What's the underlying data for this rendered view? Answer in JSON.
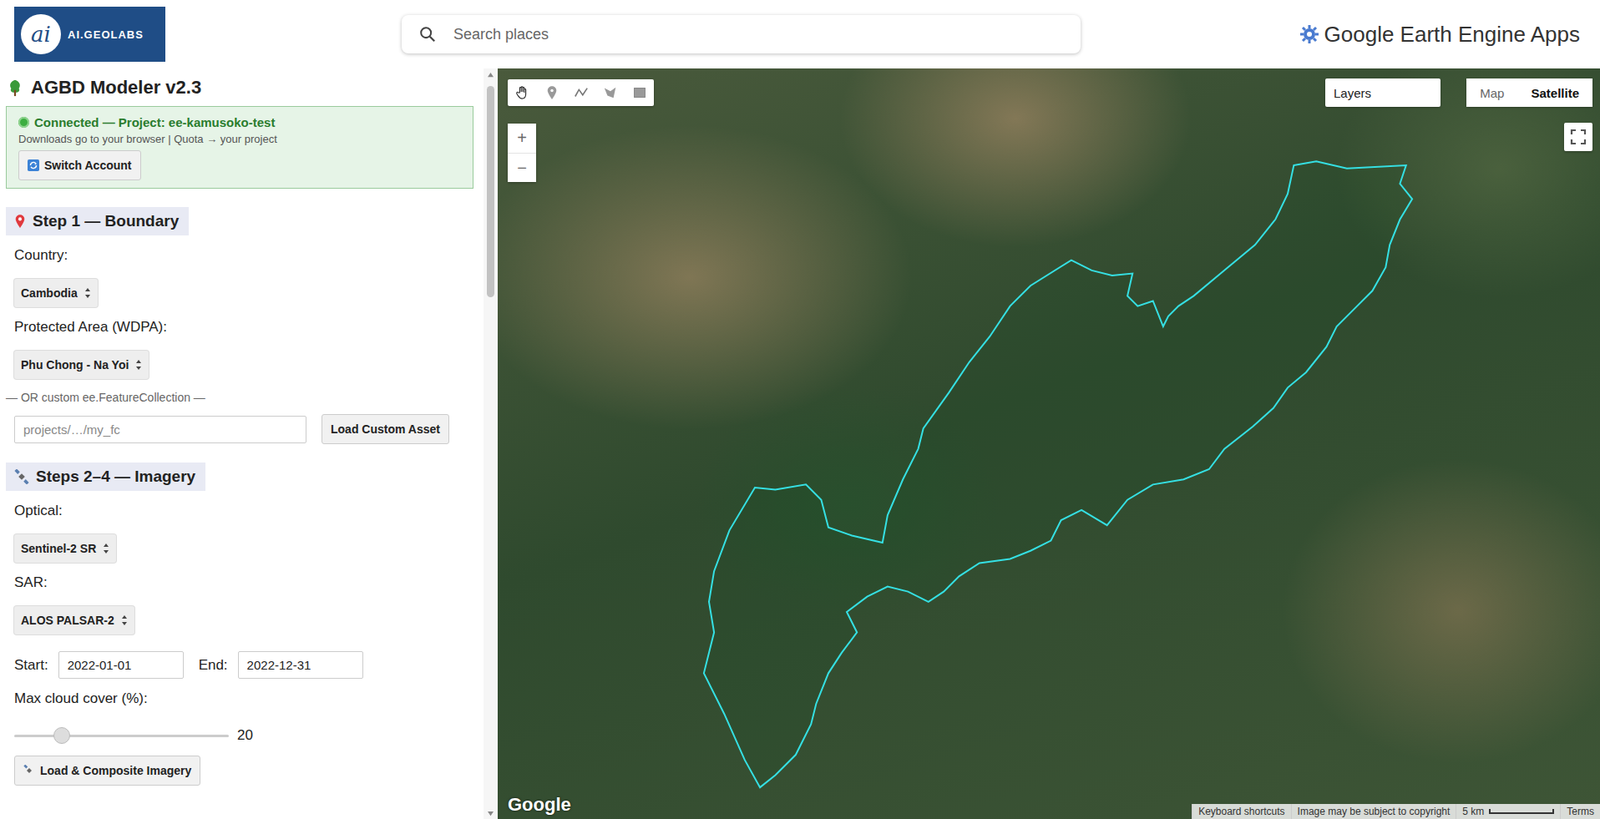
{
  "header": {
    "logo": {
      "mark": "ai",
      "name": "AI.GEOLABS"
    },
    "search": {
      "placeholder": "Search places"
    },
    "app_title": "Google Earth Engine Apps"
  },
  "panel": {
    "title": "AGBD Modeler v2.3",
    "connection": {
      "connected": true,
      "status": "Connected — Project: ee-kamusoko-test",
      "note": "Downloads go to your browser | Quota → your project",
      "button": "Switch Account"
    },
    "sections": [
      {
        "title": "Step 1 — Boundary",
        "icon": "pin",
        "fields": [
          {
            "kind": "select",
            "label": "Country:",
            "value": "Cambodia"
          },
          {
            "kind": "select",
            "label": "Protected Area (WDPA):",
            "value": "Phu Chong - Na Yoi"
          },
          {
            "kind": "note",
            "text": "— OR custom ee.FeatureCollection —"
          },
          {
            "kind": "input-button",
            "placeholder": "projects/…/my_fc",
            "button": "Load Custom Asset"
          }
        ]
      },
      {
        "title": "Steps 2–4 — Imagery",
        "icon": "satellite",
        "fields": [
          {
            "kind": "select",
            "label": "Optical:",
            "value": "Sentinel-2 SR"
          },
          {
            "kind": "select",
            "label": "SAR:",
            "value": "ALOS PALSAR-2"
          },
          {
            "kind": "date-range",
            "start_label": "Start:",
            "start": "2022-01-01",
            "end_label": "End:",
            "end": "2022-12-31"
          },
          {
            "kind": "slider",
            "label": "Max cloud cover (%):",
            "level": 0.22,
            "reading": "20"
          },
          {
            "kind": "button",
            "label": "Load & Composite Imagery"
          }
        ]
      }
    ]
  },
  "map": {
    "layers": "Layers",
    "map_types": [
      {
        "label": "Map",
        "selected": false
      },
      {
        "label": "Satellite",
        "selected": true
      }
    ],
    "zoom": [
      "+",
      "−"
    ],
    "footer": {
      "logo": "Google",
      "links": [
        "Keyboard shortcuts",
        "Image may be subject to copyright"
      ],
      "scale": "5 km",
      "terms": "Terms"
    }
  }
}
